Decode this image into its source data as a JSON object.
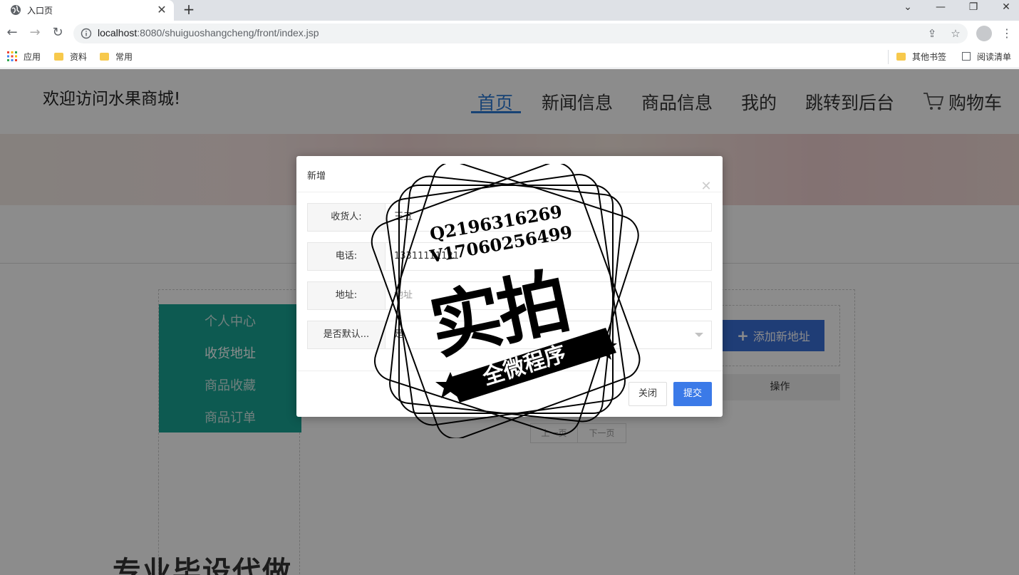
{
  "browser": {
    "tab_title": "入口页",
    "url_host": "localhost",
    "url_rest": ":8080/shuiguoshangcheng/front/index.jsp",
    "bookmarks": [
      {
        "label": "应用"
      },
      {
        "label": "资料"
      },
      {
        "label": "常用"
      }
    ],
    "other_bookmarks": "其他书签",
    "reading_list": "阅读清单"
  },
  "site": {
    "title": "欢迎访问水果商城!",
    "nav": [
      "首页",
      "新闻信息",
      "商品信息",
      "我的",
      "跳转到后台",
      "购物车"
    ]
  },
  "sidebar": {
    "items": [
      "个人中心",
      "收货地址",
      "商品收藏",
      "商品订单"
    ],
    "active_index": 1
  },
  "main": {
    "add_button": "添加新地址",
    "ops_header": "操作",
    "prev_page": "上一页",
    "next_page": "下一页",
    "footer_banner": "专业毕设代做"
  },
  "modal": {
    "title": "新增",
    "fields": [
      {
        "label": "收货人:",
        "value": "王五",
        "placeholder": ""
      },
      {
        "label": "电话:",
        "value": "13311111121",
        "placeholder": ""
      },
      {
        "label": "地址:",
        "value": "",
        "placeholder": "地址"
      },
      {
        "label": "是否默认...",
        "value": "是",
        "placeholder": ""
      }
    ],
    "close_label": "关闭",
    "submit_label": "提交"
  },
  "stamp": {
    "line1": "Q2196316269",
    "line2": "V17060256499",
    "main": "实拍",
    "ribbon": "全微程序"
  },
  "colors": {
    "nav_active": "#2d7ad6",
    "sidebar_bg": "#18a594",
    "submit_bg": "#3b7ae8",
    "add_btn_bg": "#3a6fd8"
  }
}
